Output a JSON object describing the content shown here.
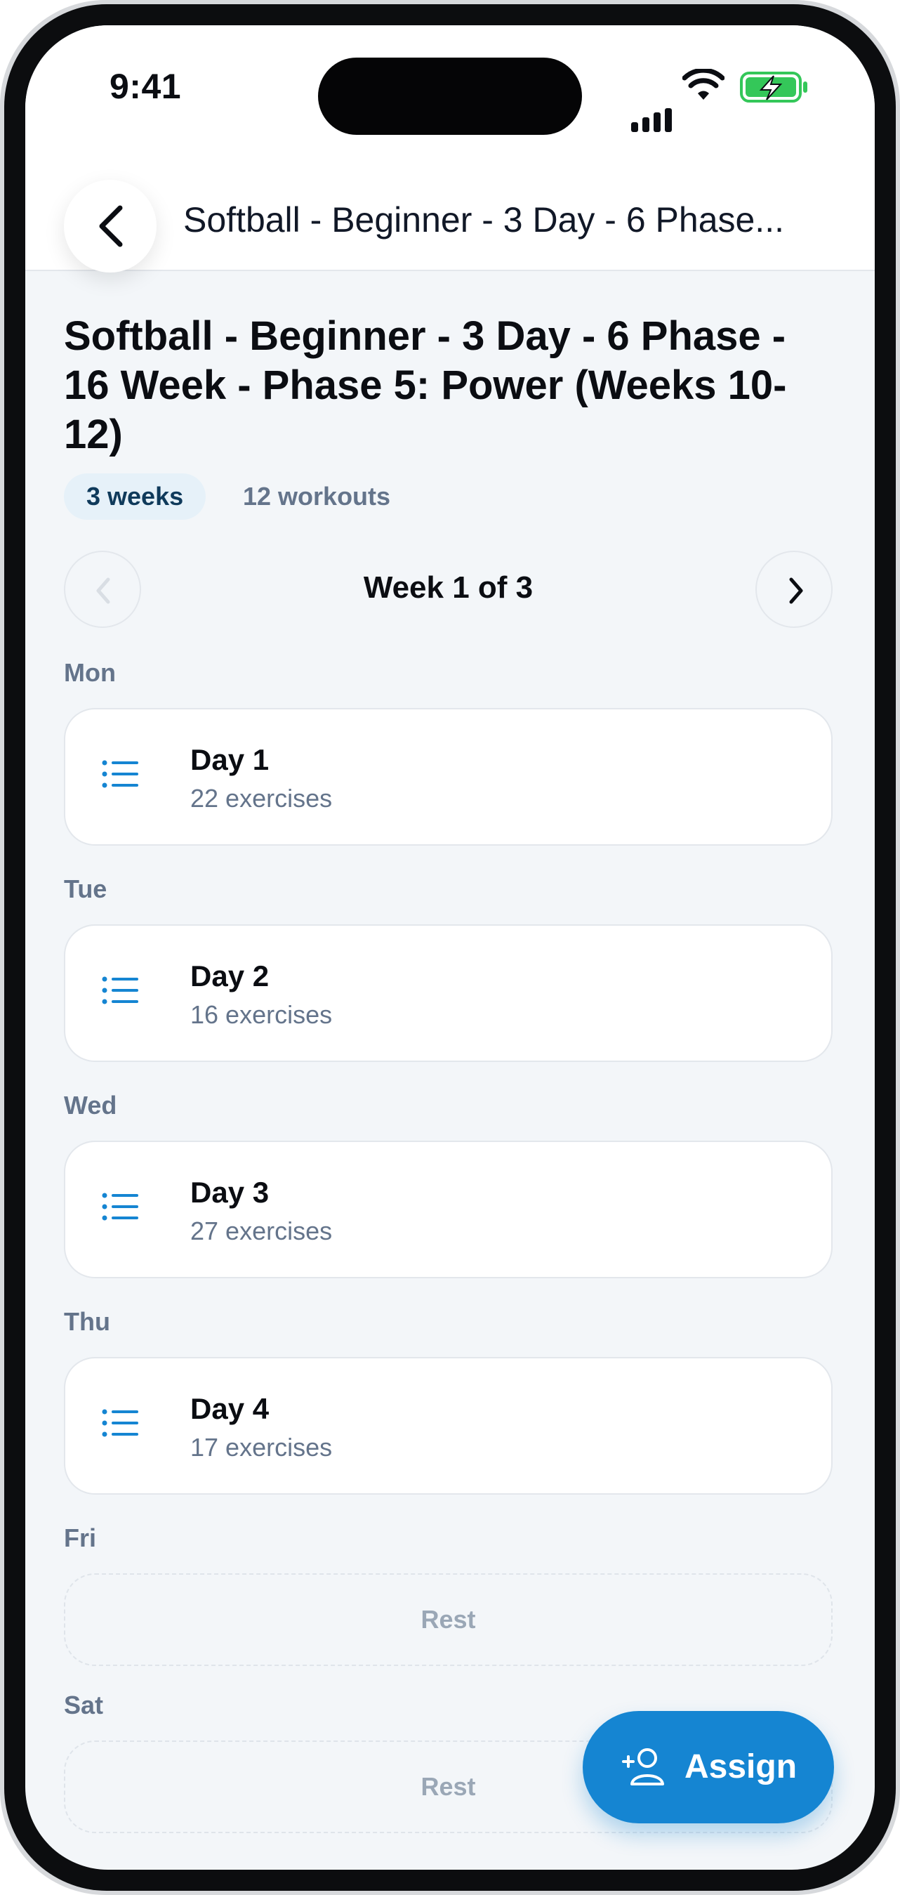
{
  "status_bar": {
    "time": "9:41"
  },
  "header": {
    "title": "Softball - Beginner - 3 Day - 6 Phase..."
  },
  "program": {
    "title": "Softball - Beginner - 3 Day - 6 Phase - 16 Week - Phase 5:  Power (Weeks 10-12)",
    "weeks_badge": "3 weeks",
    "workouts_label": "12 workouts"
  },
  "week_nav": {
    "label": "Week 1 of 3"
  },
  "days": [
    {
      "day": "Mon",
      "title": "Day 1",
      "subtitle": "22 exercises"
    },
    {
      "day": "Tue",
      "title": "Day 2",
      "subtitle": "16 exercises"
    },
    {
      "day": "Wed",
      "title": "Day 3",
      "subtitle": "27 exercises"
    },
    {
      "day": "Thu",
      "title": "Day 4",
      "subtitle": "17 exercises"
    },
    {
      "day": "Fri",
      "rest_label": "Rest"
    },
    {
      "day": "Sat",
      "rest_label": "Rest"
    }
  ],
  "assign_button": {
    "label": "Assign"
  },
  "colors": {
    "accent": "#1585d2",
    "background": "#f3f6f9",
    "muted_text": "#64748b",
    "battery": "#34c759"
  }
}
